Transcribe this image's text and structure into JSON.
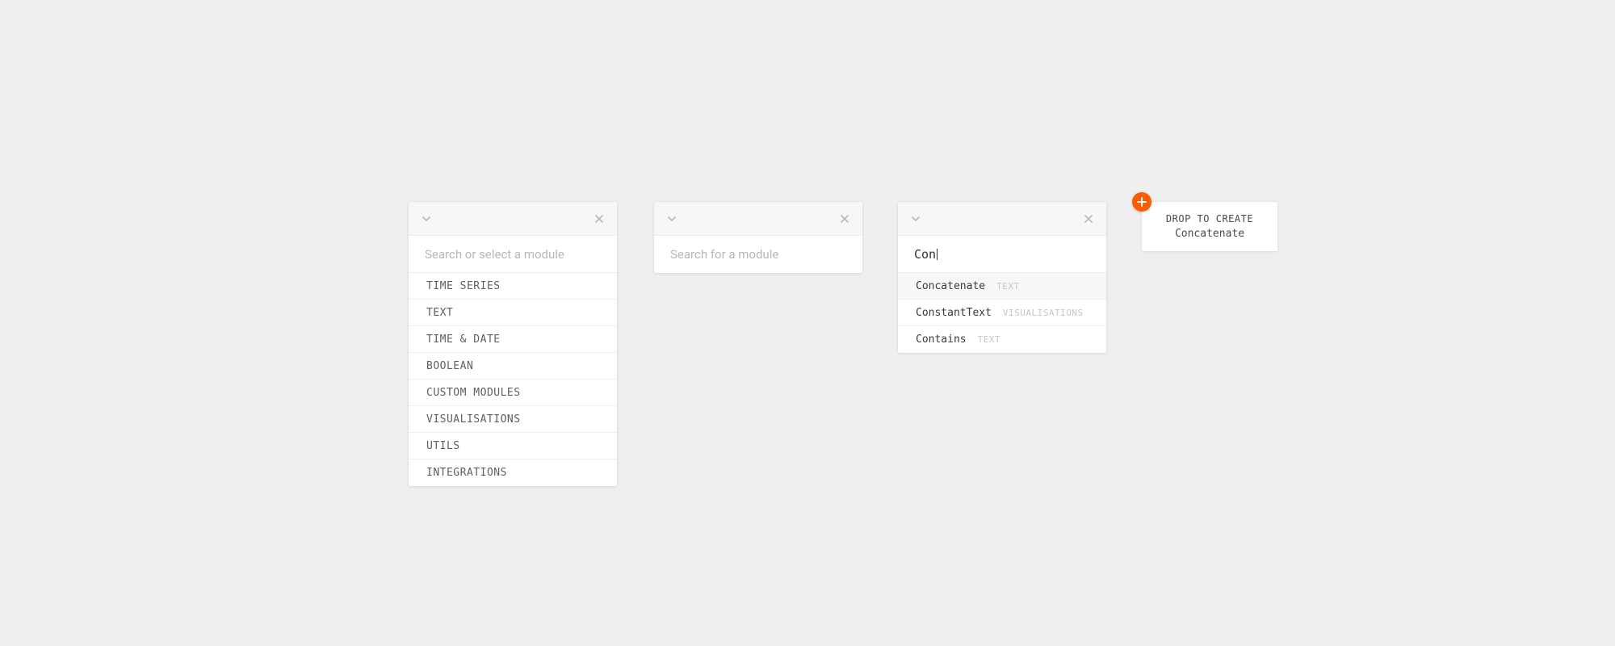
{
  "panel1": {
    "search_placeholder": "Search or select a module",
    "categories": [
      "TIME SERIES",
      "TEXT",
      "TIME & DATE",
      "BOOLEAN",
      "CUSTOM MODULES",
      "VISUALISATIONS",
      "UTILS",
      "INTEGRATIONS"
    ]
  },
  "panel2": {
    "search_placeholder": "Search for a module"
  },
  "panel3": {
    "search_value": "Con",
    "results": [
      {
        "name": "Concatenate",
        "category": "TEXT"
      },
      {
        "name": "ConstantText",
        "category": "VISUALISATIONS"
      },
      {
        "name": "Contains",
        "category": "TEXT"
      }
    ]
  },
  "drop": {
    "line1": "DROP TO CREATE",
    "line2": "Concatenate"
  }
}
